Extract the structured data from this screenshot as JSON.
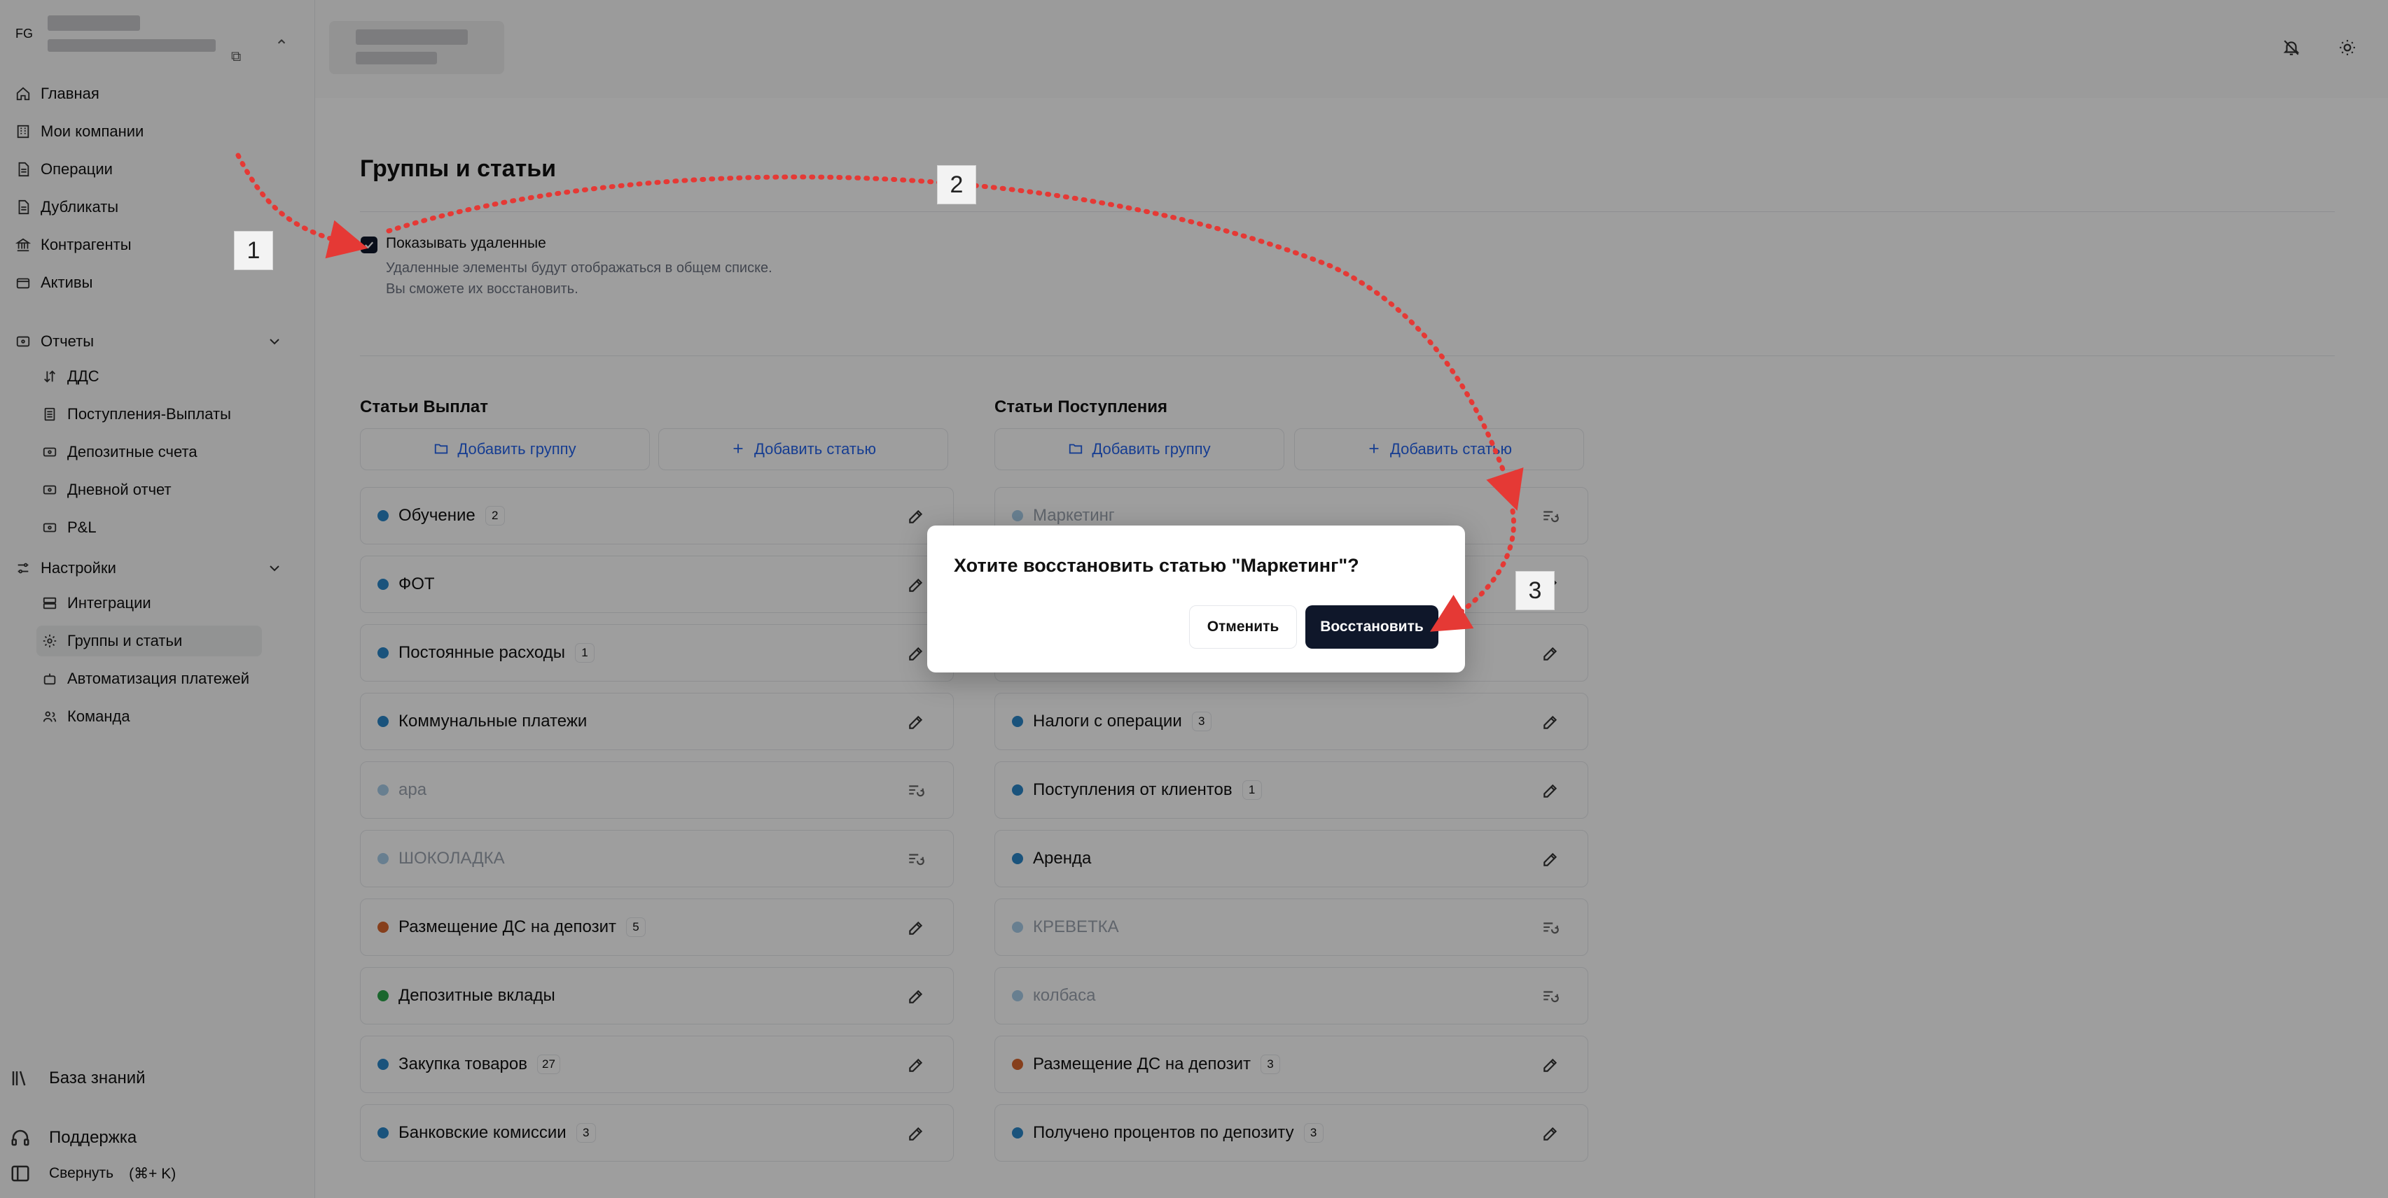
{
  "sidebar": {
    "org_badge": "FG",
    "nav": [
      {
        "label": "Главная",
        "icon": "home-icon"
      },
      {
        "label": "Мои компании",
        "icon": "building-icon"
      },
      {
        "label": "Операции",
        "icon": "file-icon"
      },
      {
        "label": "Дубликаты",
        "icon": "file-icon"
      },
      {
        "label": "Контрагенты",
        "icon": "bank-icon"
      },
      {
        "label": "Активы",
        "icon": "wallet-icon"
      }
    ],
    "reports": {
      "label": "Отчеты",
      "items": [
        "ДДС",
        "Поступления-Выплаты",
        "Депозитные счета",
        "Дневной отчет",
        "P&L"
      ]
    },
    "settings": {
      "label": "Настройки",
      "items": [
        "Интеграции",
        "Группы и статьи",
        "Автоматизация платежей",
        "Команда"
      ]
    },
    "bottom": {
      "knowledge": "База знаний",
      "support": "Поддержка",
      "collapse": "Свернуть",
      "collapse_shortcut": "(⌘+ K)"
    }
  },
  "page": {
    "title": "Группы и статьи",
    "show_deleted_label": "Показывать удаленные",
    "hint_line1": "Удаленные элементы будут отображаться в общем списке.",
    "hint_line2": "Вы сможете их восстановить."
  },
  "payments": {
    "title": "Статьи Выплат",
    "add_group": "Добавить группу",
    "add_article": "Добавить статью",
    "rows": [
      {
        "label": "Обучение",
        "count": "2",
        "color": "#2b87c9",
        "deleted": false
      },
      {
        "label": "ФОТ",
        "count": "",
        "color": "#2b87c9",
        "deleted": false
      },
      {
        "label": "Постоянные расходы",
        "count": "1",
        "color": "#2b87c9",
        "deleted": false
      },
      {
        "label": "Коммунальные платежи",
        "count": "",
        "color": "#2b87c9",
        "deleted": false
      },
      {
        "label": "ара",
        "count": "",
        "color": "#a9cde9",
        "deleted": true
      },
      {
        "label": "ШОКОЛАДКА",
        "count": "",
        "color": "#a9cde9",
        "deleted": true
      },
      {
        "label": "Размещение ДС на депозит",
        "count": "5",
        "color": "#d9662e",
        "deleted": false
      },
      {
        "label": "Депозитные вклады",
        "count": "",
        "color": "#2aa54a",
        "deleted": false
      },
      {
        "label": "Закупка товаров",
        "count": "27",
        "color": "#2b87c9",
        "deleted": false
      },
      {
        "label": "Банковские комиссии",
        "count": "3",
        "color": "#2b87c9",
        "deleted": false
      }
    ]
  },
  "income": {
    "title": "Статьи Поступления",
    "add_group": "Добавить группу",
    "add_article": "Добавить статью",
    "rows": [
      {
        "label": "Маркетинг",
        "count": "",
        "color": "#a9cde9",
        "deleted": true
      },
      {
        "label": "",
        "count": "",
        "color": "#2b87c9",
        "deleted": false
      },
      {
        "label": "",
        "count": "",
        "color": "#2b87c9",
        "deleted": false
      },
      {
        "label": "Налоги с операции",
        "count": "3",
        "color": "#2b87c9",
        "deleted": false
      },
      {
        "label": "Поступления от клиентов",
        "count": "1",
        "color": "#2b87c9",
        "deleted": false
      },
      {
        "label": "Аренда",
        "count": "",
        "color": "#2b87c9",
        "deleted": false
      },
      {
        "label": "КРЕВЕТКА",
        "count": "",
        "color": "#a9cde9",
        "deleted": true
      },
      {
        "label": "колбаса",
        "count": "",
        "color": "#a9cde9",
        "deleted": true
      },
      {
        "label": "Размещение ДС на депозит",
        "count": "3",
        "color": "#d9662e",
        "deleted": false
      },
      {
        "label": "Получено процентов по депозиту",
        "count": "3",
        "color": "#2b87c9",
        "deleted": false
      }
    ]
  },
  "dialog": {
    "title": "Хотите восстановить статью \"Маркетинг\"?",
    "cancel": "Отменить",
    "confirm": "Восстановить"
  },
  "annotations": {
    "step1": "1",
    "step2": "2",
    "step3": "3",
    "arrow_color": "#e53935"
  }
}
